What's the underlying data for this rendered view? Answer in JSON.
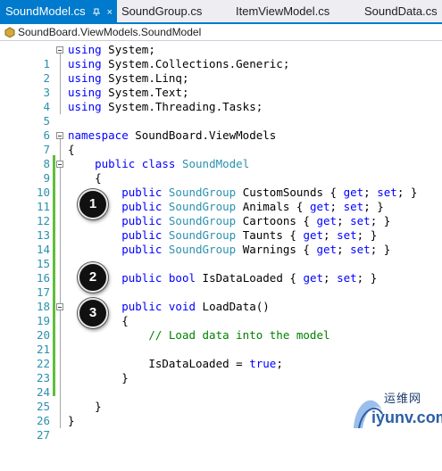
{
  "tabs": [
    {
      "label": "SoundModel.cs",
      "active": true
    },
    {
      "label": "SoundGroup.cs",
      "active": false
    },
    {
      "label": "ItemViewModel.cs",
      "active": false
    },
    {
      "label": "SoundData.cs",
      "active": false
    }
  ],
  "tab_close_glyph": "×",
  "breadcrumb": "SoundBoard.ViewModels.SoundModel",
  "line_numbers": [
    "1",
    "2",
    "3",
    "4",
    "5",
    "6",
    "7",
    "8",
    "9",
    "10",
    "11",
    "12",
    "13",
    "14",
    "15",
    "16",
    "17",
    "18",
    "19",
    "20",
    "21",
    "22",
    "23",
    "24",
    "25",
    "26",
    "27"
  ],
  "code": {
    "l1": [
      "using",
      " System;"
    ],
    "l2": [
      "using",
      " System.Collections.Generic;"
    ],
    "l3": [
      "using",
      " System.Linq;"
    ],
    "l4": [
      "using",
      " System.Text;"
    ],
    "l5": [
      "using",
      " System.Threading.Tasks;"
    ],
    "l7": [
      "namespace",
      " SoundBoard.ViewModels"
    ],
    "l8": "{",
    "l9": [
      "public",
      "class",
      "SoundModel"
    ],
    "l10": "{",
    "l11": [
      "public",
      "SoundGroup",
      " CustomSounds { ",
      "get",
      "; ",
      "set",
      "; }"
    ],
    "l12": [
      "public",
      "SoundGroup",
      " Animals { ",
      "get",
      "; ",
      "set",
      "; }"
    ],
    "l13": [
      "public",
      "SoundGroup",
      " Cartoons { ",
      "get",
      "; ",
      "set",
      "; }"
    ],
    "l14": [
      "public",
      "SoundGroup",
      " Taunts { ",
      "get",
      "; ",
      "set",
      "; }"
    ],
    "l15": [
      "public",
      "SoundGroup",
      " Warnings { ",
      "get",
      "; ",
      "set",
      "; }"
    ],
    "l17": [
      "public",
      "bool",
      " IsDataLoaded { ",
      "get",
      "; ",
      "set",
      "; }"
    ],
    "l19": [
      "public",
      "void",
      " LoadData()"
    ],
    "l20": "{",
    "l21": "// Load data into the model",
    "l23": [
      "IsDataLoaded = ",
      "true",
      ";"
    ],
    "l24": "}",
    "l26": "}",
    "l27": "}"
  },
  "badges": [
    "1",
    "2",
    "3"
  ],
  "watermark": {
    "text_cn": "运维网",
    "url": "iyunv.com"
  },
  "colors": {
    "accent": "#007acc",
    "keyword": "#0000ff",
    "type": "#2b91af",
    "comment": "#008000",
    "change_bar": "#5ebf3a"
  }
}
